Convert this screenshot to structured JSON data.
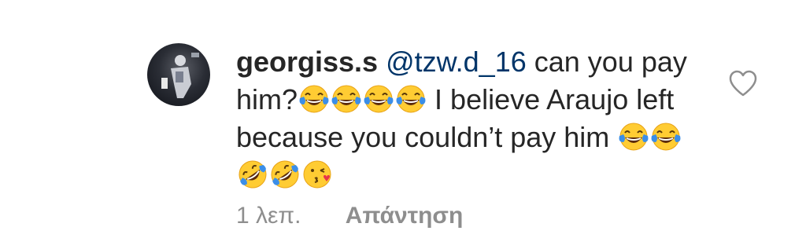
{
  "comment": {
    "username": "georgiss.s",
    "mention": "@tzw.d_16",
    "text_part1": "can you pay him?",
    "text_part2": "I believe Araujo left because you couldn’t pay him",
    "emojis_group1": [
      "face-with-tears-of-joy",
      "face-with-tears-of-joy",
      "face-with-tears-of-joy",
      "face-with-tears-of-joy"
    ],
    "emojis_group2": [
      "face-with-tears-of-joy",
      "face-with-tears-of-joy",
      "rolling-on-the-floor-laughing",
      "rolling-on-the-floor-laughing",
      "face-blowing-a-kiss"
    ]
  },
  "meta": {
    "time": "1 λεπ.",
    "reply_label": "Απάντηση"
  },
  "icons": {
    "like": "heart-outline-icon"
  },
  "colors": {
    "text": "#262626",
    "mention": "#003569",
    "secondary": "#8e8e8e"
  }
}
